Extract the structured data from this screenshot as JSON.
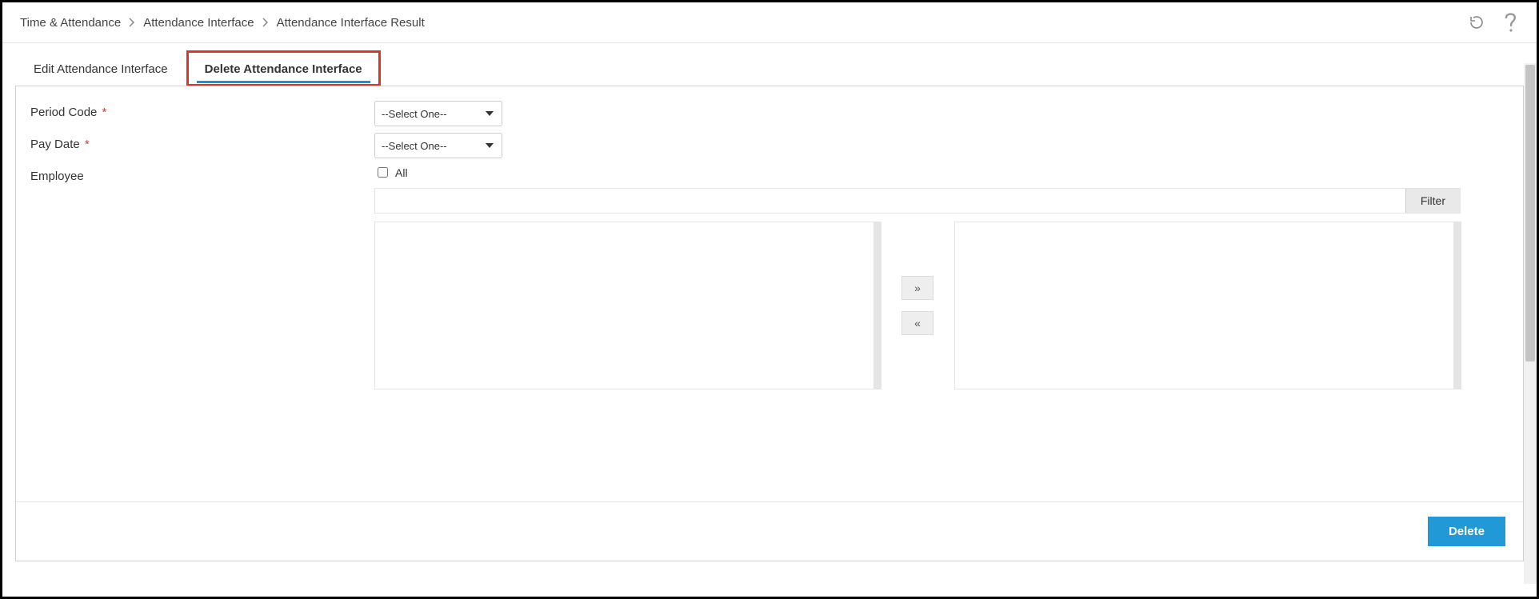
{
  "breadcrumb": {
    "item1": "Time & Attendance",
    "item2": "Attendance Interface",
    "item3": "Attendance Interface Result"
  },
  "tabs": {
    "edit": "Edit Attendance Interface",
    "delete": "Delete Attendance Interface"
  },
  "form": {
    "period_code_label": "Period Code",
    "pay_date_label": "Pay Date",
    "employee_label": "Employee",
    "all_label": "All",
    "select_placeholder": "--Select One--",
    "filter_label": "Filter",
    "move_right": "»",
    "move_left": "«"
  },
  "actions": {
    "delete": "Delete"
  }
}
